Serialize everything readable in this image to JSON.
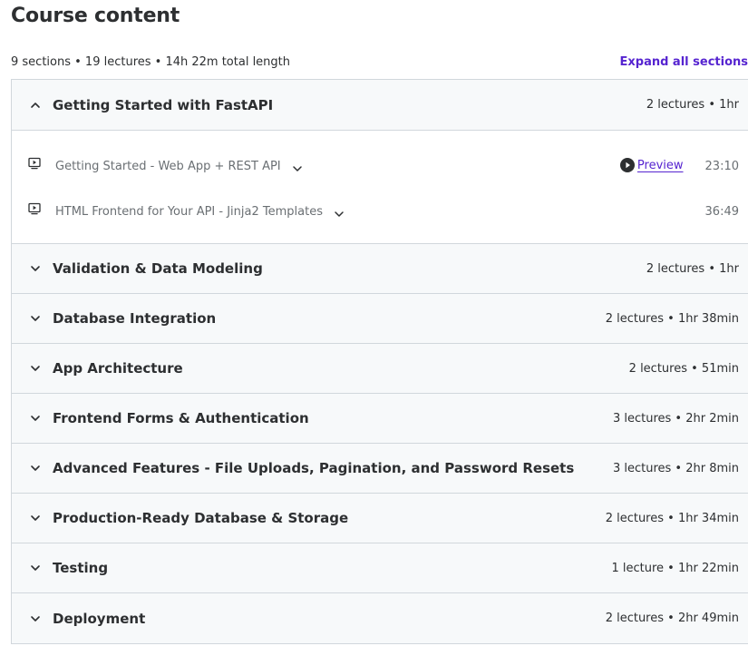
{
  "page": {
    "title": "Course content",
    "summary": "9 sections • 19 lectures • 14h 22m total length",
    "expand_all_label": "Expand all sections"
  },
  "sections": [
    {
      "title": "Getting Started with FastAPI",
      "meta": "2 lectures • 1hr",
      "expanded": true,
      "lectures": [
        {
          "title": "Getting Started - Web App + REST API",
          "preview_label": "Preview",
          "duration": "23:10"
        },
        {
          "title": "HTML Frontend for Your API - Jinja2 Templates",
          "duration": "36:49"
        }
      ]
    },
    {
      "title": "Validation & Data Modeling",
      "meta": "2 lectures • 1hr",
      "expanded": false
    },
    {
      "title": "Database Integration",
      "meta": "2 lectures • 1hr 38min",
      "expanded": false
    },
    {
      "title": "App Architecture",
      "meta": "2 lectures • 51min",
      "expanded": false
    },
    {
      "title": "Frontend Forms & Authentication",
      "meta": "3 lectures • 2hr 2min",
      "expanded": false
    },
    {
      "title": "Advanced Features - File Uploads, Pagination, and Password Resets",
      "meta": "3 lectures • 2hr 8min",
      "expanded": false
    },
    {
      "title": "Production-Ready Database & Storage",
      "meta": "2 lectures • 1hr 34min",
      "expanded": false
    },
    {
      "title": "Testing",
      "meta": "1 lecture • 1hr 22min",
      "expanded": false
    },
    {
      "title": "Deployment",
      "meta": "2 lectures • 2hr 49min",
      "expanded": false
    }
  ],
  "icons": {
    "section_chevron_expanded": "chevron-up-icon",
    "section_chevron_collapsed": "chevron-down-icon",
    "lecture": "video-play-icon",
    "preview": "play-circle-icon"
  },
  "colors": {
    "text": "#2d2f31",
    "muted_text": "#6a6f73",
    "accent": "#5624d0",
    "header_bg": "#f7f9fa",
    "border": "#d1d7dc"
  }
}
